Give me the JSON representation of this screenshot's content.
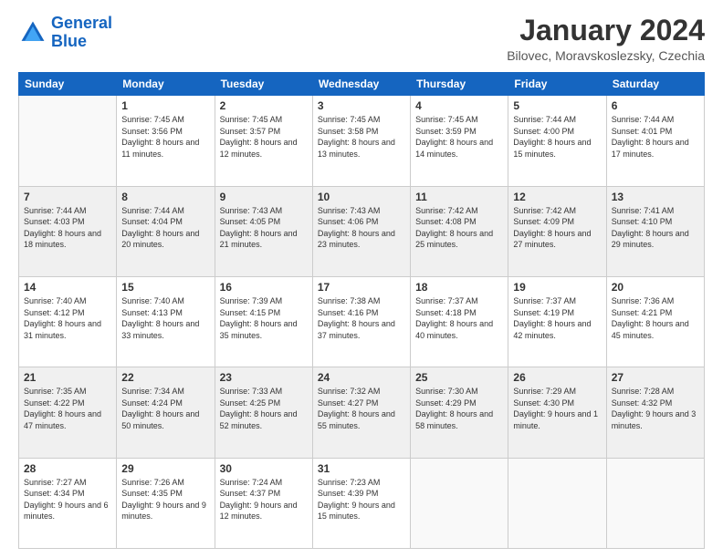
{
  "header": {
    "logo": {
      "line1": "General",
      "line2": "Blue"
    },
    "title": "January 2024",
    "location": "Bilovec, Moravskoslezsky, Czechia"
  },
  "weekdays": [
    "Sunday",
    "Monday",
    "Tuesday",
    "Wednesday",
    "Thursday",
    "Friday",
    "Saturday"
  ],
  "weeks": [
    [
      {
        "day": "",
        "sunrise": "",
        "sunset": "",
        "daylight": ""
      },
      {
        "day": "1",
        "sunrise": "Sunrise: 7:45 AM",
        "sunset": "Sunset: 3:56 PM",
        "daylight": "Daylight: 8 hours and 11 minutes."
      },
      {
        "day": "2",
        "sunrise": "Sunrise: 7:45 AM",
        "sunset": "Sunset: 3:57 PM",
        "daylight": "Daylight: 8 hours and 12 minutes."
      },
      {
        "day": "3",
        "sunrise": "Sunrise: 7:45 AM",
        "sunset": "Sunset: 3:58 PM",
        "daylight": "Daylight: 8 hours and 13 minutes."
      },
      {
        "day": "4",
        "sunrise": "Sunrise: 7:45 AM",
        "sunset": "Sunset: 3:59 PM",
        "daylight": "Daylight: 8 hours and 14 minutes."
      },
      {
        "day": "5",
        "sunrise": "Sunrise: 7:44 AM",
        "sunset": "Sunset: 4:00 PM",
        "daylight": "Daylight: 8 hours and 15 minutes."
      },
      {
        "day": "6",
        "sunrise": "Sunrise: 7:44 AM",
        "sunset": "Sunset: 4:01 PM",
        "daylight": "Daylight: 8 hours and 17 minutes."
      }
    ],
    [
      {
        "day": "7",
        "sunrise": "Sunrise: 7:44 AM",
        "sunset": "Sunset: 4:03 PM",
        "daylight": "Daylight: 8 hours and 18 minutes."
      },
      {
        "day": "8",
        "sunrise": "Sunrise: 7:44 AM",
        "sunset": "Sunset: 4:04 PM",
        "daylight": "Daylight: 8 hours and 20 minutes."
      },
      {
        "day": "9",
        "sunrise": "Sunrise: 7:43 AM",
        "sunset": "Sunset: 4:05 PM",
        "daylight": "Daylight: 8 hours and 21 minutes."
      },
      {
        "day": "10",
        "sunrise": "Sunrise: 7:43 AM",
        "sunset": "Sunset: 4:06 PM",
        "daylight": "Daylight: 8 hours and 23 minutes."
      },
      {
        "day": "11",
        "sunrise": "Sunrise: 7:42 AM",
        "sunset": "Sunset: 4:08 PM",
        "daylight": "Daylight: 8 hours and 25 minutes."
      },
      {
        "day": "12",
        "sunrise": "Sunrise: 7:42 AM",
        "sunset": "Sunset: 4:09 PM",
        "daylight": "Daylight: 8 hours and 27 minutes."
      },
      {
        "day": "13",
        "sunrise": "Sunrise: 7:41 AM",
        "sunset": "Sunset: 4:10 PM",
        "daylight": "Daylight: 8 hours and 29 minutes."
      }
    ],
    [
      {
        "day": "14",
        "sunrise": "Sunrise: 7:40 AM",
        "sunset": "Sunset: 4:12 PM",
        "daylight": "Daylight: 8 hours and 31 minutes."
      },
      {
        "day": "15",
        "sunrise": "Sunrise: 7:40 AM",
        "sunset": "Sunset: 4:13 PM",
        "daylight": "Daylight: 8 hours and 33 minutes."
      },
      {
        "day": "16",
        "sunrise": "Sunrise: 7:39 AM",
        "sunset": "Sunset: 4:15 PM",
        "daylight": "Daylight: 8 hours and 35 minutes."
      },
      {
        "day": "17",
        "sunrise": "Sunrise: 7:38 AM",
        "sunset": "Sunset: 4:16 PM",
        "daylight": "Daylight: 8 hours and 37 minutes."
      },
      {
        "day": "18",
        "sunrise": "Sunrise: 7:37 AM",
        "sunset": "Sunset: 4:18 PM",
        "daylight": "Daylight: 8 hours and 40 minutes."
      },
      {
        "day": "19",
        "sunrise": "Sunrise: 7:37 AM",
        "sunset": "Sunset: 4:19 PM",
        "daylight": "Daylight: 8 hours and 42 minutes."
      },
      {
        "day": "20",
        "sunrise": "Sunrise: 7:36 AM",
        "sunset": "Sunset: 4:21 PM",
        "daylight": "Daylight: 8 hours and 45 minutes."
      }
    ],
    [
      {
        "day": "21",
        "sunrise": "Sunrise: 7:35 AM",
        "sunset": "Sunset: 4:22 PM",
        "daylight": "Daylight: 8 hours and 47 minutes."
      },
      {
        "day": "22",
        "sunrise": "Sunrise: 7:34 AM",
        "sunset": "Sunset: 4:24 PM",
        "daylight": "Daylight: 8 hours and 50 minutes."
      },
      {
        "day": "23",
        "sunrise": "Sunrise: 7:33 AM",
        "sunset": "Sunset: 4:25 PM",
        "daylight": "Daylight: 8 hours and 52 minutes."
      },
      {
        "day": "24",
        "sunrise": "Sunrise: 7:32 AM",
        "sunset": "Sunset: 4:27 PM",
        "daylight": "Daylight: 8 hours and 55 minutes."
      },
      {
        "day": "25",
        "sunrise": "Sunrise: 7:30 AM",
        "sunset": "Sunset: 4:29 PM",
        "daylight": "Daylight: 8 hours and 58 minutes."
      },
      {
        "day": "26",
        "sunrise": "Sunrise: 7:29 AM",
        "sunset": "Sunset: 4:30 PM",
        "daylight": "Daylight: 9 hours and 1 minute."
      },
      {
        "day": "27",
        "sunrise": "Sunrise: 7:28 AM",
        "sunset": "Sunset: 4:32 PM",
        "daylight": "Daylight: 9 hours and 3 minutes."
      }
    ],
    [
      {
        "day": "28",
        "sunrise": "Sunrise: 7:27 AM",
        "sunset": "Sunset: 4:34 PM",
        "daylight": "Daylight: 9 hours and 6 minutes."
      },
      {
        "day": "29",
        "sunrise": "Sunrise: 7:26 AM",
        "sunset": "Sunset: 4:35 PM",
        "daylight": "Daylight: 9 hours and 9 minutes."
      },
      {
        "day": "30",
        "sunrise": "Sunrise: 7:24 AM",
        "sunset": "Sunset: 4:37 PM",
        "daylight": "Daylight: 9 hours and 12 minutes."
      },
      {
        "day": "31",
        "sunrise": "Sunrise: 7:23 AM",
        "sunset": "Sunset: 4:39 PM",
        "daylight": "Daylight: 9 hours and 15 minutes."
      },
      {
        "day": "",
        "sunrise": "",
        "sunset": "",
        "daylight": ""
      },
      {
        "day": "",
        "sunrise": "",
        "sunset": "",
        "daylight": ""
      },
      {
        "day": "",
        "sunrise": "",
        "sunset": "",
        "daylight": ""
      }
    ]
  ]
}
